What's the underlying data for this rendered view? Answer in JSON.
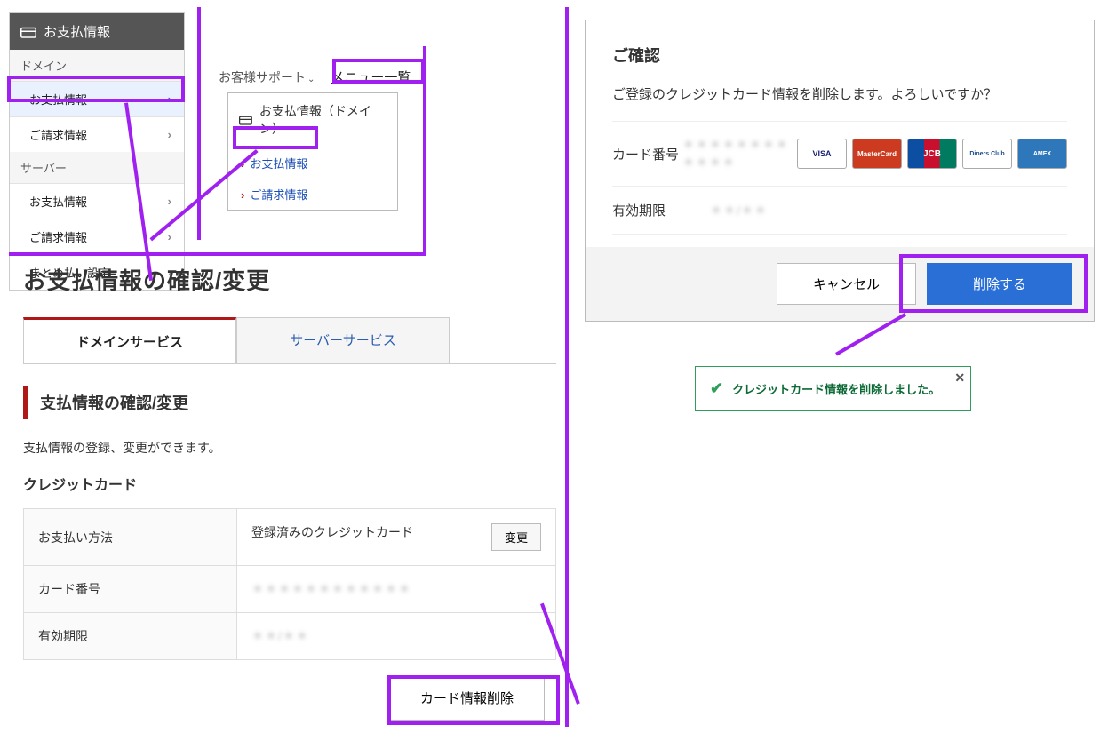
{
  "sidebar": {
    "title": "お支払情報",
    "groups": [
      {
        "label": "ドメイン",
        "items": [
          {
            "label": "お支払情報",
            "active": true
          },
          {
            "label": "ご請求情報"
          }
        ]
      },
      {
        "label": "サーバー",
        "items": [
          {
            "label": "お支払情報"
          },
          {
            "label": "ご請求情報"
          },
          {
            "label": "まとめ払い設定"
          }
        ]
      }
    ]
  },
  "topmenu": {
    "support": "お客様サポート",
    "menu_list": "メニュー一覧"
  },
  "popover": {
    "title": "お支払情報（ドメイン）",
    "items": [
      "お支払情報",
      "ご請求情報"
    ]
  },
  "main": {
    "title": "お支払情報の確認/変更",
    "tabs": [
      "ドメインサービス",
      "サーバーサービス"
    ],
    "section_title": "支払情報の確認/変更",
    "section_note": "支払情報の登録、変更ができます。",
    "subsection": "クレジットカード",
    "rows": {
      "method_label": "お支払い方法",
      "method_value": "登録済みのクレジットカード",
      "change_btn": "変更",
      "cardno_label": "カード番号",
      "cardno_value": "＊＊＊＊＊＊＊＊＊＊＊＊",
      "exp_label": "有効期限",
      "exp_value": "＊＊/＊＊"
    },
    "delete_btn": "カード情報削除"
  },
  "modal": {
    "title": "ご確認",
    "text": "ご登録のクレジットカード情報を削除します。よろしいですか？",
    "cardno_label": "カード番号",
    "cardno_value": "＊＊＊＊＊＊＊＊＊＊＊＊",
    "exp_label": "有効期限",
    "exp_value": "＊＊/＊＊",
    "brands": [
      "VISA",
      "MasterCard",
      "JCB",
      "Diners Club",
      "AMEX"
    ],
    "cancel": "キャンセル",
    "confirm": "削除する"
  },
  "toast": {
    "text": "クレジットカード情報を削除しました。"
  }
}
